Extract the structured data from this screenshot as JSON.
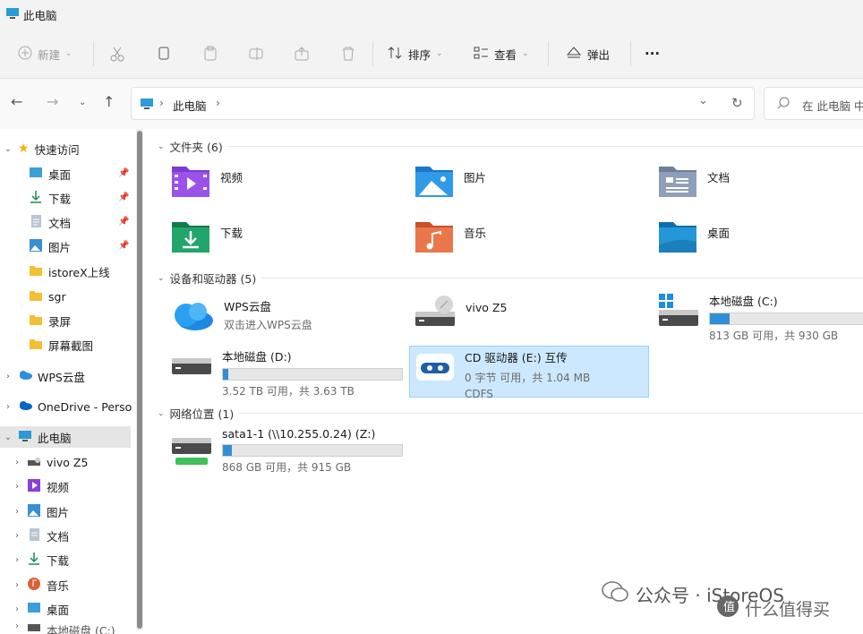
{
  "window": {
    "title": "此电脑"
  },
  "toolbar": {
    "new_label": "新建",
    "sort_label": "排序",
    "view_label": "查看",
    "eject_label": "弹出",
    "more_label": "···"
  },
  "address": {
    "crumb": "此电脑",
    "search_placeholder": "在 此电脑 中"
  },
  "sidebar": {
    "quick_access": "快速访问",
    "quick_items": [
      "桌面",
      "下载",
      "文档",
      "图片",
      "istoreX上线",
      "sgr",
      "录屏",
      "屏幕截图"
    ],
    "wps": "WPS云盘",
    "onedrive": "OneDrive - Perso",
    "thispc": "此电脑",
    "pc_items": [
      "vivo Z5",
      "视频",
      "图片",
      "文档",
      "下载",
      "音乐",
      "桌面",
      "本地磁盘 (C:)"
    ]
  },
  "main": {
    "folders_header": "文件夹 (6)",
    "folders": [
      "视频",
      "图片",
      "文档",
      "下载",
      "音乐",
      "桌面"
    ],
    "devices_header": "设备和驱动器 (5)",
    "wps_name": "WPS云盘",
    "wps_sub": "双击进入WPS云盘",
    "vivo_name": "vivo Z5",
    "c_name": "本地磁盘 (C:)",
    "c_free": "813 GB 可用，共 930 GB",
    "c_used_fraction": 0.126,
    "d_name": "本地磁盘 (D:)",
    "d_free": "3.52 TB 可用，共 3.63 TB",
    "d_used_fraction": 0.03,
    "cd_name": "CD 驱动器 (E:) 互传",
    "cd_free": "0 字节 可用，共 1.04 MB",
    "cd_fs": "CDFS",
    "net_header": "网络位置 (1)",
    "net_name": "sata1-1 (\\\\10.255.0.24) (Z:)",
    "net_free": "868 GB 可用，共 915 GB",
    "net_used_fraction": 0.05
  },
  "watermark": {
    "text1": "公众号 · iStoreOS",
    "text2": "什么值得买"
  },
  "colors": {
    "accent": "#2f8fd4",
    "selection": "#cce8ff"
  }
}
